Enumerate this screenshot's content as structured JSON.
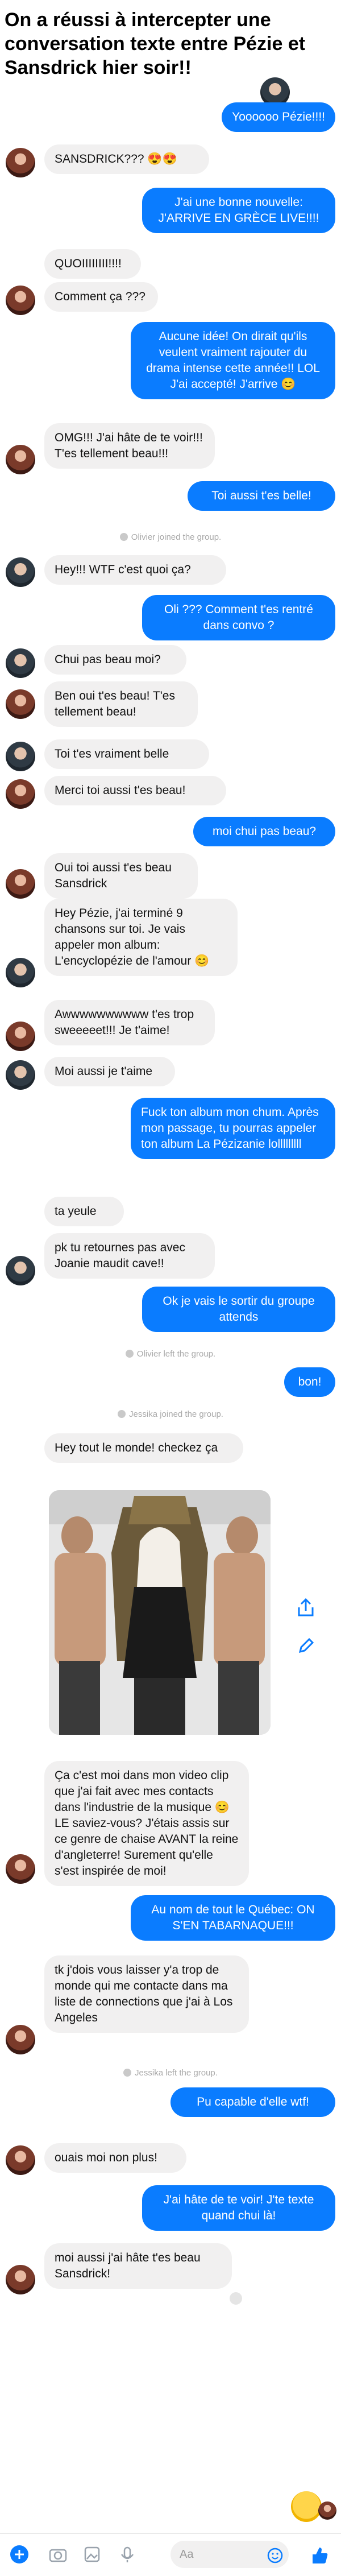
{
  "headline": "On a réussi à intercepter une conversation texte entre Pézie et Sansdrick hier soir!!",
  "colors": {
    "outgoing": "#0a7cff",
    "incoming": "#f1f0f0",
    "system_text": "#a9a9a9"
  },
  "messages": [
    "Yoooooo Pézie!!!!",
    "SANSDRICK??? 😍😍",
    "J'ai une bonne nouvelle: J'ARRIVE EN GRÈCE LIVE!!!!",
    "QUOIIIIIIII!!!!",
    "Comment ça ???",
    "Aucune idée! On dirait qu'ils veulent vraiment rajouter du drama intense cette année!! LOL J'ai accepté! J'arrive 😊",
    "OMG!!! J'ai hâte de te voir!!! T'es tellement beau!!!",
    "Toi aussi t'es belle!",
    "Hey!!! WTF c'est quoi ça?",
    "Oli ??? Comment t'es rentré dans convo ?",
    "Chui pas beau moi?",
    "Ben oui t'es beau! T'es tellement beau!",
    "Toi t'es vraiment belle",
    "Merci toi aussi t'es beau!",
    "moi chui pas beau?",
    "Oui toi aussi t'es beau Sansdrick",
    "Hey Pézie, j'ai terminé 9 chansons sur toi. Je vais appeler mon album: L'encyclopézie de l'amour 😊",
    "Awwwwwwwwww t'es trop sweeeeet!!! Je t'aime!",
    "Moi aussi je t'aime",
    "Fuck ton album mon chum. Après mon passage, tu pourras appeler ton album La Pézizanie lolllllllll",
    "ta yeule",
    "pk tu retournes pas avec Joanie maudit cave!!",
    "Ok je vais le sortir du groupe attends",
    "bon!",
    "Hey tout le monde! checkez ça",
    "Ça c'est moi dans mon video clip que j'ai fait avec mes contacts dans l'industrie de la musique 😊 LE saviez-vous? J'étais assis sur ce genre de chaise AVANT la reine d'angleterre! Surement qu'elle s'est inspirée de moi!",
    "Au nom de tout le Québec: ON S'EN TABARNAQUE!!!",
    "tk j'dois vous laisser y'a trop de monde qui me contacte dans ma liste de connections que j'ai à Los Angeles",
    "Pu capable d'elle wtf!",
    "ouais moi non plus!",
    "J'ai hâte de te voir! J'te texte quand chui là!",
    "moi aussi j'ai hâte t'es beau Sansdrick!"
  ],
  "system": [
    "Olivier joined the group.",
    "Olivier left the group.",
    "Jessika joined the group.",
    "Jessika left the group."
  ],
  "composer": {
    "placeholder": "Aa"
  },
  "icons": [
    "plus-icon",
    "camera-icon",
    "gallery-icon",
    "mic-icon",
    "emoji-icon",
    "thumbs-up-icon",
    "share-icon",
    "edit-icon"
  ]
}
